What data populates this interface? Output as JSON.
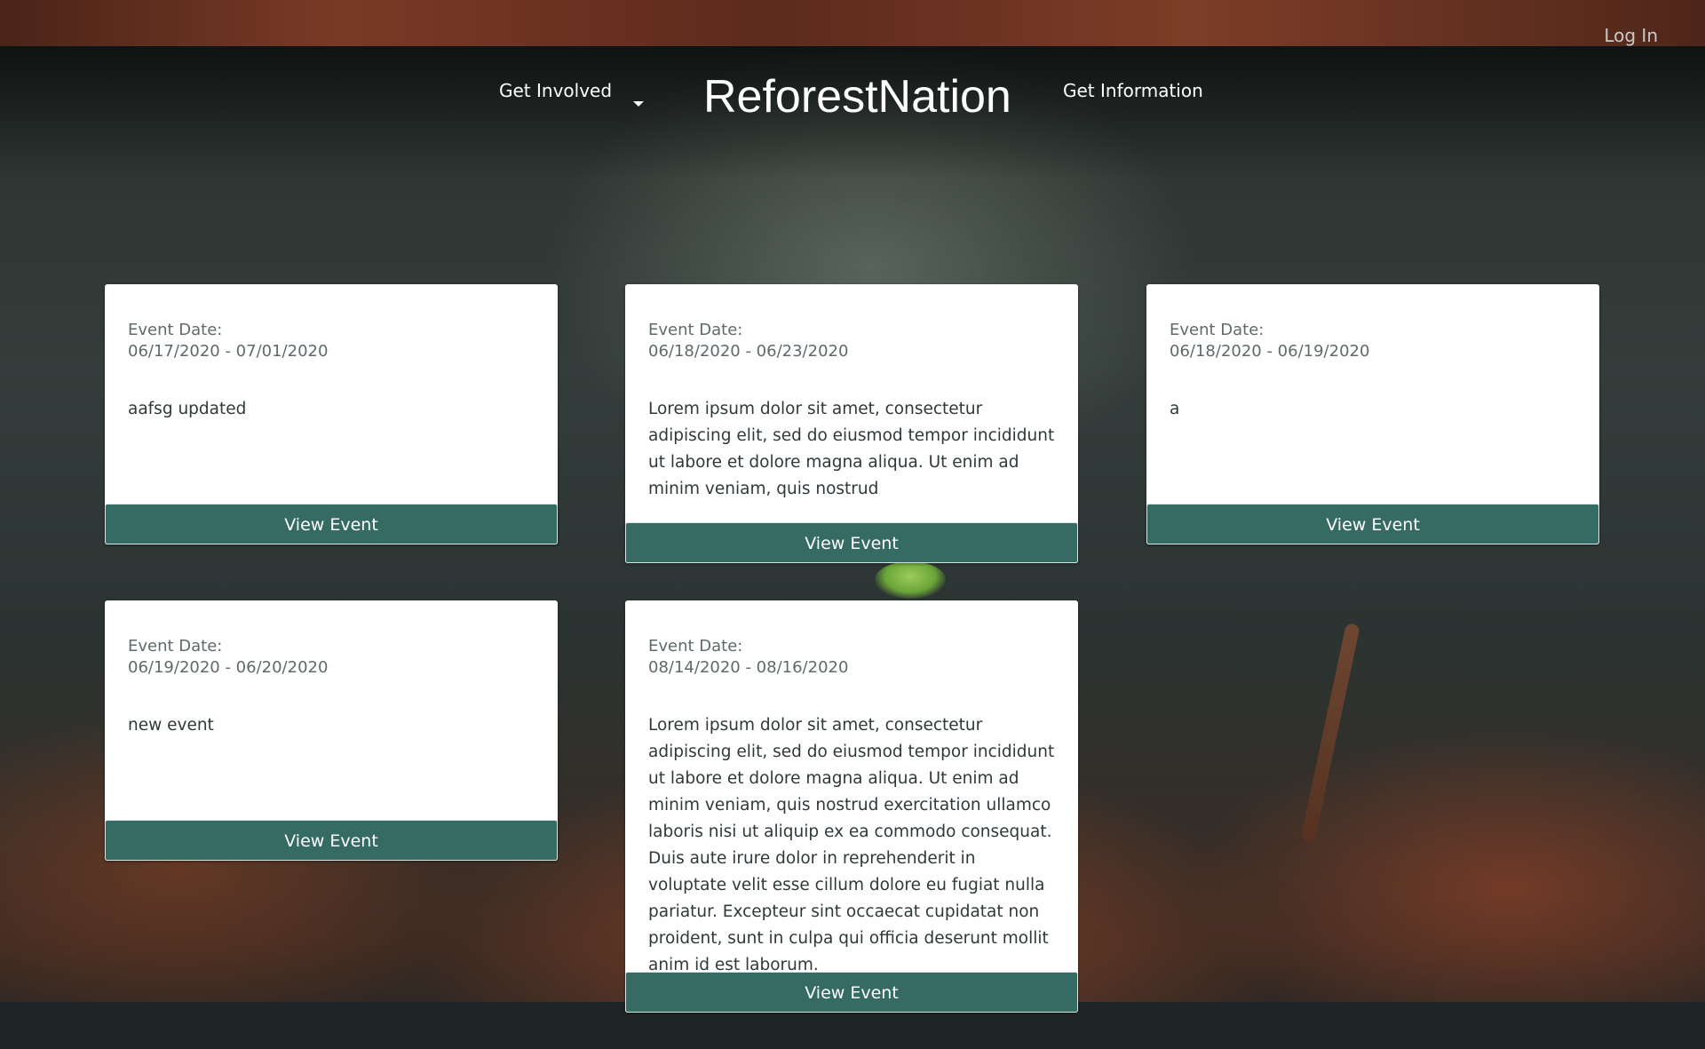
{
  "header": {
    "login_label": "Log In",
    "nav_left_label": "Get Involved",
    "brand": "ReforestNation",
    "nav_right_label": "Get Information"
  },
  "events": [
    {
      "date_label": "Event Date:",
      "date_range": "06/17/2020 - 07/01/2020",
      "description": "aafsg updated",
      "button_label": "View Event"
    },
    {
      "date_label": "Event Date:",
      "date_range": "06/18/2020 - 06/23/2020",
      "description": "Lorem ipsum dolor sit amet, consectetur adipiscing elit, sed do eiusmod tempor incididunt ut labore et dolore magna aliqua. Ut enim ad minim veniam, quis nostrud",
      "button_label": "View Event"
    },
    {
      "date_label": "Event Date:",
      "date_range": "06/18/2020 - 06/19/2020",
      "description": "a",
      "button_label": "View Event"
    },
    {
      "date_label": "Event Date:",
      "date_range": "06/19/2020 - 06/20/2020",
      "description": "new event",
      "button_label": "View Event"
    },
    {
      "date_label": "Event Date:",
      "date_range": "08/14/2020 - 08/16/2020",
      "description": "Lorem ipsum dolor sit amet, consectetur adipiscing elit, sed do eiusmod tempor incididunt ut labore et dolore magna aliqua. Ut enim ad minim veniam, quis nostrud exercitation ullamco laboris nisi ut aliquip ex ea commodo consequat. Duis aute irure dolor in reprehenderit in voluptate velit esse cillum dolore eu fugiat nulla pariatur. Excepteur sint occaecat cupidatat non proident, sunt in culpa qui officia deserunt mollit anim id est laborum.",
      "button_label": "View Event"
    }
  ],
  "colors": {
    "button_bg": "#356b63",
    "card_bg": "#ffffff",
    "date_text": "#5f6a6a"
  }
}
